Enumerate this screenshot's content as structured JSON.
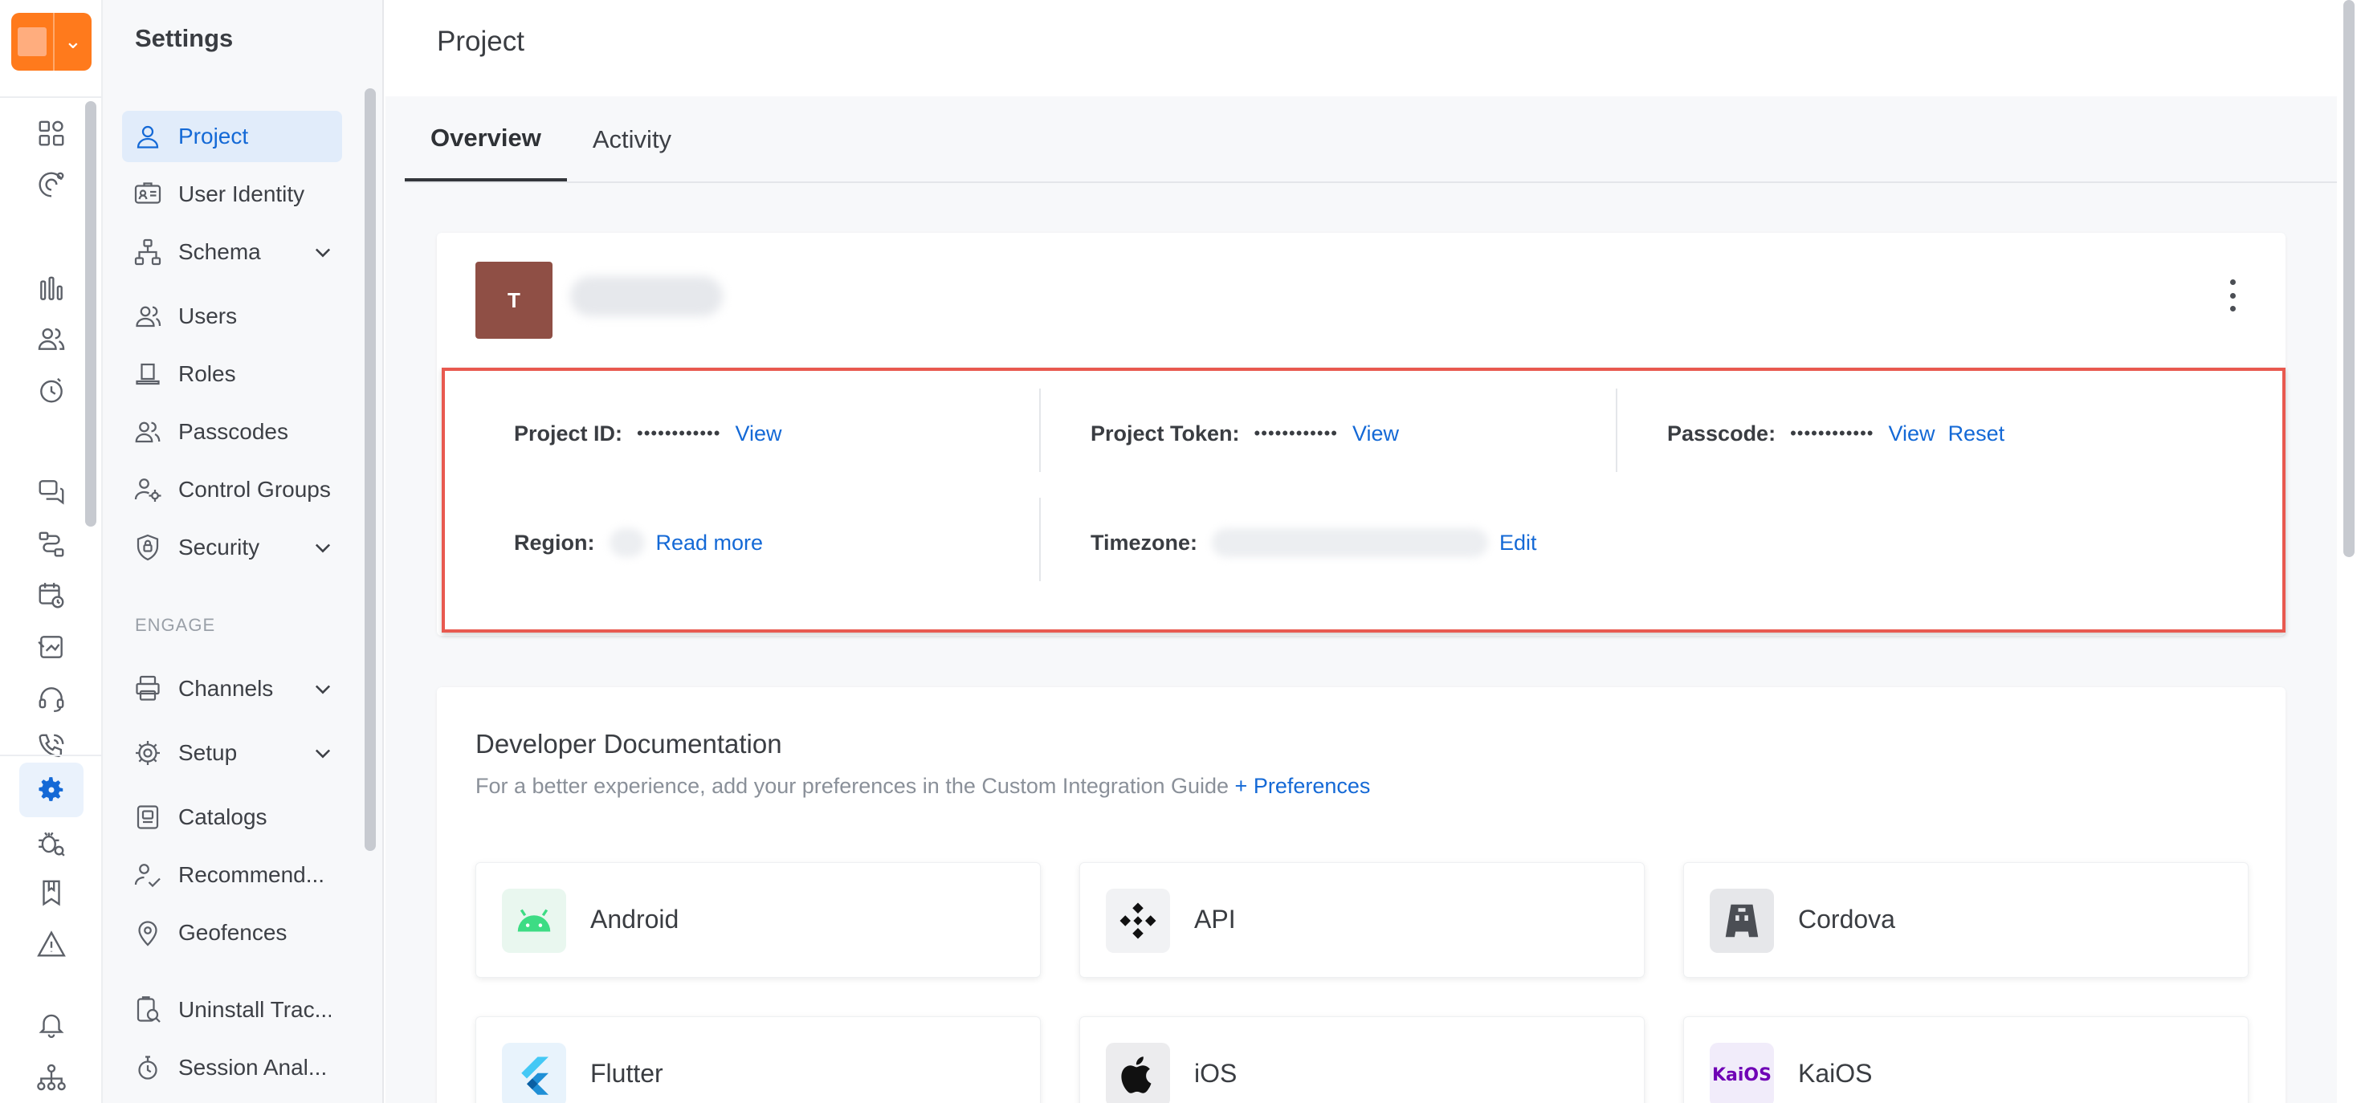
{
  "sidebar": {
    "title": "Settings",
    "section_engage": "ENGAGE",
    "items": [
      {
        "label": "Project",
        "icon": "user-icon"
      },
      {
        "label": "User Identity",
        "icon": "id-card-icon"
      },
      {
        "label": "Schema",
        "icon": "schema-icon"
      },
      {
        "label": "Users",
        "icon": "users-icon"
      },
      {
        "label": "Roles",
        "icon": "hat-icon"
      },
      {
        "label": "Passcodes",
        "icon": "passcode-users-icon"
      },
      {
        "label": "Control Groups",
        "icon": "control-group-icon"
      },
      {
        "label": "Security",
        "icon": "shield-icon"
      },
      {
        "label": "Channels",
        "icon": "channels-icon"
      },
      {
        "label": "Setup",
        "icon": "gear-icon"
      },
      {
        "label": "Catalogs",
        "icon": "catalog-icon"
      },
      {
        "label": "Recommend...",
        "icon": "recommend-icon"
      },
      {
        "label": "Geofences",
        "icon": "pin-icon"
      },
      {
        "label": "Uninstall Trac...",
        "icon": "uninstall-icon"
      },
      {
        "label": "Session Anal...",
        "icon": "session-icon"
      }
    ]
  },
  "header": {
    "title": "Project"
  },
  "tabs": [
    {
      "label": "Overview"
    },
    {
      "label": "Activity"
    }
  ],
  "project": {
    "avatar_initial": "T",
    "fields": {
      "project_id": {
        "label": "Project ID:",
        "mask": "••••••••••••",
        "action": "View"
      },
      "project_token": {
        "label": "Project Token:",
        "mask": "••••••••••••",
        "action": "View"
      },
      "passcode": {
        "label": "Passcode:",
        "mask": "••••••••••••",
        "action": "View",
        "action2": "Reset"
      },
      "region": {
        "label": "Region:",
        "action": "Read more"
      },
      "timezone": {
        "label": "Timezone:",
        "action": "Edit"
      }
    }
  },
  "docs": {
    "title": "Developer Documentation",
    "subtitle": "For a better experience, add your preferences in the Custom Integration Guide",
    "preferences_link": "+ Preferences",
    "platforms": [
      {
        "label": "Android",
        "icon": "android-icon"
      },
      {
        "label": "API",
        "icon": "api-icon"
      },
      {
        "label": "Cordova",
        "icon": "cordova-icon"
      },
      {
        "label": "Flutter",
        "icon": "flutter-icon"
      },
      {
        "label": "iOS",
        "icon": "apple-icon"
      },
      {
        "label": "KaiOS",
        "icon": "kaios-icon",
        "logo_text": "KaiOS"
      }
    ]
  },
  "colors": {
    "accent": "#1469d6",
    "highlight_border": "#e8594f",
    "logo": "#ff7a1c",
    "avatar": "#8f4f45"
  }
}
